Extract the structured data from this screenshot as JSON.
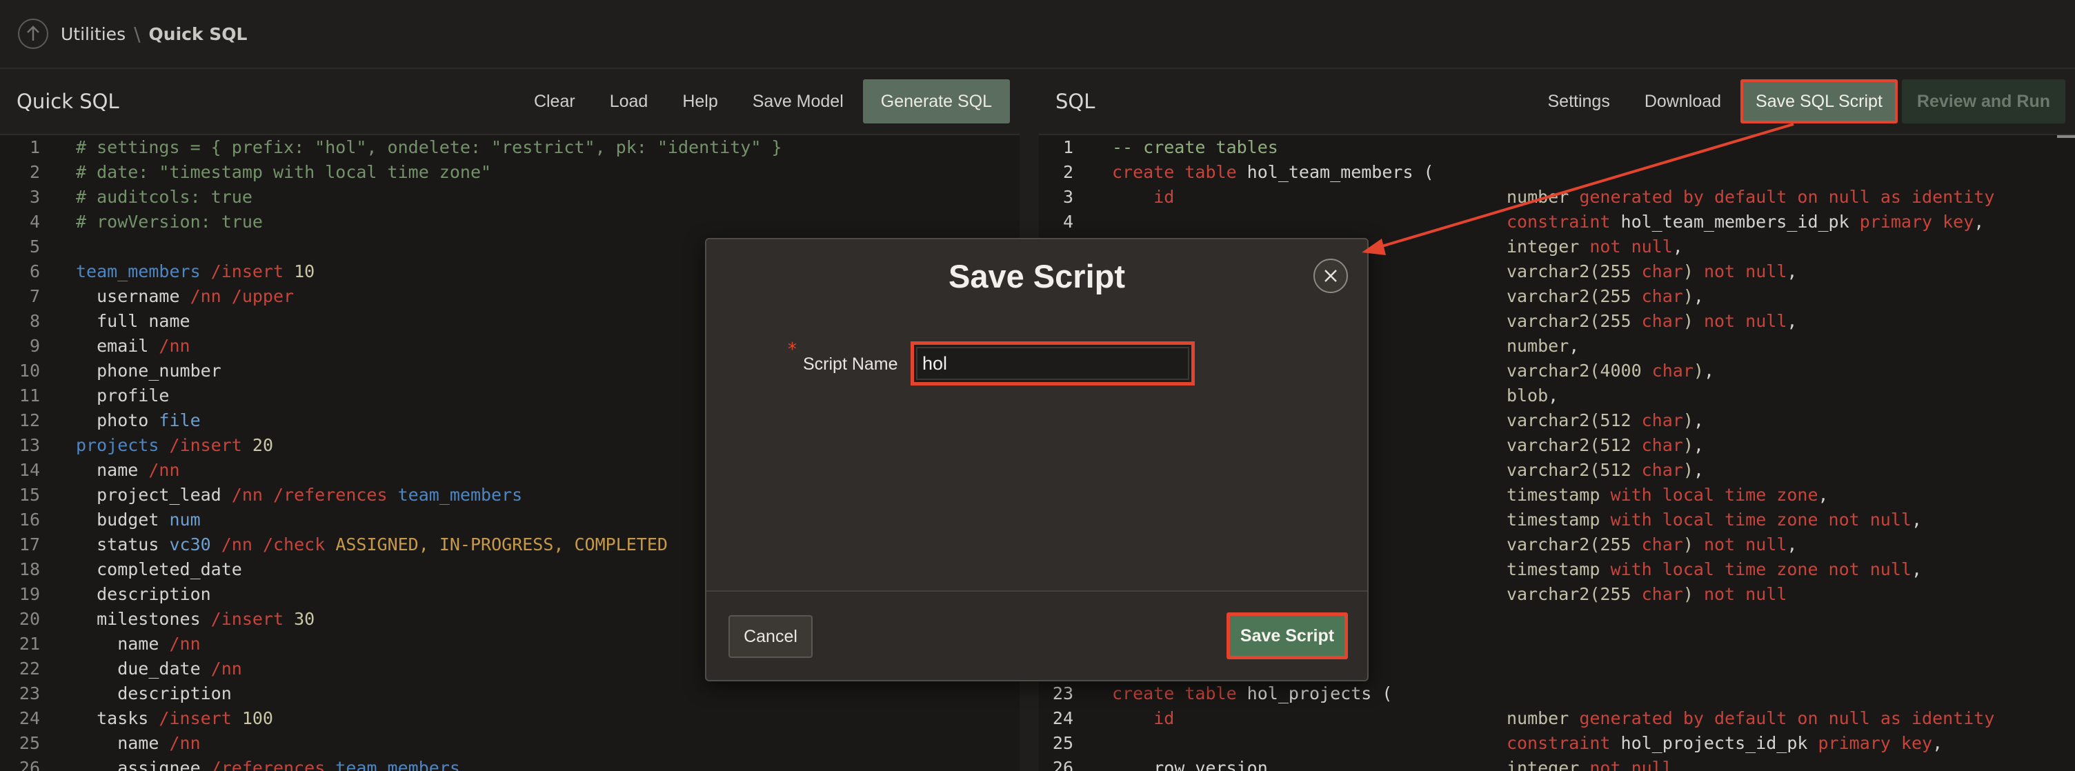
{
  "breadcrumb": {
    "parent": "Utilities",
    "separator": "\\",
    "current": "Quick SQL"
  },
  "left_pane": {
    "title": "Quick SQL",
    "toolbar": [
      "Clear",
      "Load",
      "Help",
      "Save Model",
      "Generate SQL"
    ],
    "lines": [
      {
        "n": "1",
        "t": [
          [
            "c-cmt",
            "# settings = { prefix: \"hol\", ondelete: \"restrict\", pk: \"identity\" }"
          ]
        ]
      },
      {
        "n": "2",
        "t": [
          [
            "c-cmt",
            "# date: \"timestamp with local time zone\""
          ]
        ]
      },
      {
        "n": "3",
        "t": [
          [
            "c-cmt",
            "# auditcols: true"
          ]
        ]
      },
      {
        "n": "4",
        "t": [
          [
            "c-cmt",
            "# rowVersion: true"
          ]
        ]
      },
      {
        "n": "5",
        "t": []
      },
      {
        "n": "6",
        "t": [
          [
            "c-tbl",
            "team_members"
          ],
          [
            "c-dir",
            " /insert"
          ],
          [
            "c-num",
            " 10"
          ]
        ]
      },
      {
        "n": "7",
        "t": [
          [
            "c-pl",
            "  username"
          ],
          [
            "c-dir",
            " /nn /upper"
          ]
        ]
      },
      {
        "n": "8",
        "t": [
          [
            "c-pl",
            "  full name"
          ]
        ]
      },
      {
        "n": "9",
        "t": [
          [
            "c-pl",
            "  email"
          ],
          [
            "c-dir",
            " /nn"
          ]
        ]
      },
      {
        "n": "10",
        "t": [
          [
            "c-pl",
            "  phone_number"
          ]
        ]
      },
      {
        "n": "11",
        "t": [
          [
            "c-pl",
            "  profile"
          ]
        ]
      },
      {
        "n": "12",
        "t": [
          [
            "c-pl",
            "  photo"
          ],
          [
            "c-ty",
            " file"
          ]
        ]
      },
      {
        "n": "13",
        "t": [
          [
            "c-tbl",
            "projects"
          ],
          [
            "c-dir",
            " /insert"
          ],
          [
            "c-num",
            " 20"
          ]
        ]
      },
      {
        "n": "14",
        "t": [
          [
            "c-pl",
            "  name"
          ],
          [
            "c-dir",
            " /nn"
          ]
        ]
      },
      {
        "n": "15",
        "t": [
          [
            "c-pl",
            "  project_lead"
          ],
          [
            "c-dir",
            " /nn /references"
          ],
          [
            "c-tbl",
            " team_members"
          ]
        ]
      },
      {
        "n": "16",
        "t": [
          [
            "c-pl",
            "  budget"
          ],
          [
            "c-ty",
            " num"
          ]
        ]
      },
      {
        "n": "17",
        "t": [
          [
            "c-pl",
            "  status"
          ],
          [
            "c-ty",
            " vc30"
          ],
          [
            "c-dir",
            " /nn /check"
          ],
          [
            "c-str",
            " ASSIGNED, IN-PROGRESS, COMPLETED"
          ]
        ]
      },
      {
        "n": "18",
        "t": [
          [
            "c-pl",
            "  completed_date"
          ]
        ]
      },
      {
        "n": "19",
        "t": [
          [
            "c-pl",
            "  description"
          ]
        ]
      },
      {
        "n": "20",
        "t": [
          [
            "c-pl",
            "  milestones"
          ],
          [
            "c-dir",
            " /insert"
          ],
          [
            "c-num",
            " 30"
          ]
        ]
      },
      {
        "n": "21",
        "t": [
          [
            "c-pl",
            "    name"
          ],
          [
            "c-dir",
            " /nn"
          ]
        ]
      },
      {
        "n": "22",
        "t": [
          [
            "c-pl",
            "    due_date"
          ],
          [
            "c-dir",
            " /nn"
          ]
        ]
      },
      {
        "n": "23",
        "t": [
          [
            "c-pl",
            "    description"
          ]
        ]
      },
      {
        "n": "24",
        "t": [
          [
            "c-pl",
            "  tasks"
          ],
          [
            "c-dir",
            " /insert"
          ],
          [
            "c-num",
            " 100"
          ]
        ]
      },
      {
        "n": "25",
        "t": [
          [
            "c-pl",
            "    name"
          ],
          [
            "c-dir",
            " /nn"
          ]
        ]
      },
      {
        "n": "26",
        "t": [
          [
            "c-pl",
            "    assignee"
          ],
          [
            "c-dir",
            " /references"
          ],
          [
            "c-tbl",
            " team_members"
          ]
        ]
      }
    ]
  },
  "right_pane": {
    "title": "SQL",
    "toolbar": [
      "Settings",
      "Download",
      "Save SQL Script",
      "Review and Run"
    ],
    "lines": [
      {
        "n": "1",
        "t": [
          [
            "c-sq",
            "-- create tables"
          ]
        ]
      },
      {
        "n": "2",
        "t": [
          [
            "c-kw",
            "create table"
          ],
          [
            "c-pl",
            " hol_team_members ("
          ]
        ]
      },
      {
        "n": "3",
        "t": [
          [
            "c-pl",
            "    "
          ],
          [
            "c-kw",
            "id"
          ],
          [
            "c-pl",
            "                                "
          ],
          [
            "c-ty2",
            "number"
          ],
          [
            "c-kw",
            " generated by default on null as identity"
          ]
        ]
      },
      {
        "n": "4",
        "t": [
          [
            "c-pl",
            "                                      "
          ],
          [
            "c-kw",
            "constraint"
          ],
          [
            "c-pl",
            " hol_team_members_id_pk "
          ],
          [
            "c-kw",
            "primary key"
          ],
          [
            "c-pl",
            ","
          ]
        ]
      },
      {
        "n": "",
        "t": [
          [
            "c-pl",
            "                                      "
          ],
          [
            "c-ty2",
            "integer"
          ],
          [
            "c-kw",
            " not null"
          ],
          [
            "c-pl",
            ","
          ]
        ]
      },
      {
        "n": "",
        "t": [
          [
            "c-pl",
            "                                      "
          ],
          [
            "c-ty2",
            "varchar2(255"
          ],
          [
            "c-kw",
            " char"
          ],
          [
            "c-ty2",
            ")"
          ],
          [
            "c-kw",
            " not null"
          ],
          [
            "c-pl",
            ","
          ]
        ]
      },
      {
        "n": "",
        "t": [
          [
            "c-pl",
            "                                      "
          ],
          [
            "c-ty2",
            "varchar2(255"
          ],
          [
            "c-kw",
            " char"
          ],
          [
            "c-ty2",
            ")"
          ],
          [
            "c-pl",
            ","
          ]
        ]
      },
      {
        "n": "",
        "t": [
          [
            "c-pl",
            "                                      "
          ],
          [
            "c-ty2",
            "varchar2(255"
          ],
          [
            "c-kw",
            " char"
          ],
          [
            "c-ty2",
            ")"
          ],
          [
            "c-kw",
            " not null"
          ],
          [
            "c-pl",
            ","
          ]
        ]
      },
      {
        "n": "",
        "t": [
          [
            "c-pl",
            "                                      "
          ],
          [
            "c-ty2",
            "number"
          ],
          [
            "c-pl",
            ","
          ]
        ]
      },
      {
        "n": "",
        "t": [
          [
            "c-pl",
            "                                      "
          ],
          [
            "c-ty2",
            "varchar2(4000"
          ],
          [
            "c-kw",
            " char"
          ],
          [
            "c-ty2",
            ")"
          ],
          [
            "c-pl",
            ","
          ]
        ]
      },
      {
        "n": "",
        "t": [
          [
            "c-pl",
            "                                      "
          ],
          [
            "c-ty2",
            "blob"
          ],
          [
            "c-pl",
            ","
          ]
        ]
      },
      {
        "n": "",
        "t": [
          [
            "c-pl",
            "                                      "
          ],
          [
            "c-ty2",
            "varchar2(512"
          ],
          [
            "c-kw",
            " char"
          ],
          [
            "c-ty2",
            ")"
          ],
          [
            "c-pl",
            ","
          ]
        ]
      },
      {
        "n": "",
        "t": [
          [
            "c-pl",
            "                                      "
          ],
          [
            "c-ty2",
            "varchar2(512"
          ],
          [
            "c-kw",
            " char"
          ],
          [
            "c-ty2",
            ")"
          ],
          [
            "c-pl",
            ","
          ]
        ]
      },
      {
        "n": "",
        "t": [
          [
            "c-pl",
            "                                      "
          ],
          [
            "c-ty2",
            "varchar2(512"
          ],
          [
            "c-kw",
            " char"
          ],
          [
            "c-ty2",
            ")"
          ],
          [
            "c-pl",
            ","
          ]
        ]
      },
      {
        "n": "",
        "t": [
          [
            "c-pl",
            "                                      "
          ],
          [
            "c-ty2",
            "timestamp"
          ],
          [
            "c-kw",
            " with local time zone"
          ],
          [
            "c-pl",
            ","
          ]
        ]
      },
      {
        "n": "",
        "t": [
          [
            "c-pl",
            "                                      "
          ],
          [
            "c-ty2",
            "timestamp"
          ],
          [
            "c-kw",
            " with local time zone not null"
          ],
          [
            "c-pl",
            ","
          ]
        ]
      },
      {
        "n": "",
        "t": [
          [
            "c-pl",
            "                                      "
          ],
          [
            "c-ty2",
            "varchar2(255"
          ],
          [
            "c-kw",
            " char"
          ],
          [
            "c-ty2",
            ")"
          ],
          [
            "c-kw",
            " not null"
          ],
          [
            "c-pl",
            ","
          ]
        ]
      },
      {
        "n": "",
        "t": [
          [
            "c-pl",
            "                                      "
          ],
          [
            "c-ty2",
            "timestamp"
          ],
          [
            "c-kw",
            " with local time zone not null"
          ],
          [
            "c-pl",
            ","
          ]
        ]
      },
      {
        "n": "",
        "t": [
          [
            "c-pl",
            "                                      "
          ],
          [
            "c-ty2",
            "varchar2(255"
          ],
          [
            "c-kw",
            " char"
          ],
          [
            "c-ty2",
            ")"
          ],
          [
            "c-kw",
            " not null"
          ]
        ]
      },
      {
        "n": "",
        "t": []
      },
      {
        "n": "",
        "t": []
      },
      {
        "n": "",
        "t": []
      },
      {
        "n": "23",
        "t": [
          [
            "c-kw",
            "create table"
          ],
          [
            "c-pl",
            " hol_projects ("
          ]
        ]
      },
      {
        "n": "24",
        "t": [
          [
            "c-pl",
            "    "
          ],
          [
            "c-kw",
            "id"
          ],
          [
            "c-pl",
            "                                "
          ],
          [
            "c-ty2",
            "number"
          ],
          [
            "c-kw",
            " generated by default on null as identity"
          ]
        ]
      },
      {
        "n": "25",
        "t": [
          [
            "c-pl",
            "                                      "
          ],
          [
            "c-kw",
            "constraint"
          ],
          [
            "c-pl",
            " hol_projects_id_pk "
          ],
          [
            "c-kw",
            "primary key"
          ],
          [
            "c-pl",
            ","
          ]
        ]
      },
      {
        "n": "26",
        "t": [
          [
            "c-pl",
            "    row_version                       "
          ],
          [
            "c-ty2",
            "integer"
          ],
          [
            "c-kw",
            " not null"
          ]
        ]
      }
    ]
  },
  "modal": {
    "title": "Save Script",
    "required_mark": "*",
    "field_label": "Script Name",
    "field_value": "hol",
    "cancel_label": "Cancel",
    "save_label": "Save Script"
  },
  "colors": {
    "accent_red": "#e2442d",
    "primary_green": "#4d7656"
  }
}
